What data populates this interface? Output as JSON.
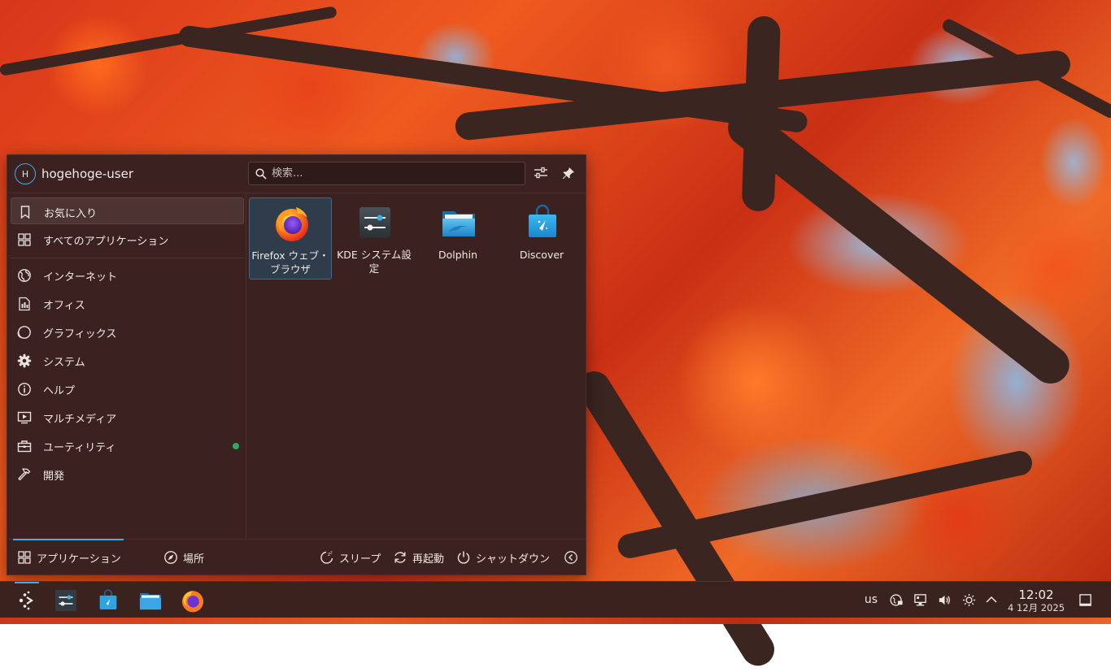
{
  "launcher": {
    "user": {
      "initial": "H",
      "name": "hogehoge-user"
    },
    "search": {
      "placeholder": "検索..."
    },
    "header_icons": {
      "configure": "sliders-icon",
      "pin": "pin-icon"
    },
    "sidebar": {
      "items": [
        {
          "label": "お気に入り",
          "icon": "bookmark-icon"
        },
        {
          "label": "すべてのアプリケーション",
          "icon": "grid-icon"
        },
        {
          "label": "インターネット",
          "icon": "globe-icon"
        },
        {
          "label": "オフィス",
          "icon": "document-icon"
        },
        {
          "label": "グラフィックス",
          "icon": "graphics-icon"
        },
        {
          "label": "システム",
          "icon": "gear-icon"
        },
        {
          "label": "ヘルプ",
          "icon": "info-icon"
        },
        {
          "label": "マルチメディア",
          "icon": "monitor-play-icon"
        },
        {
          "label": "ユーティリティ",
          "icon": "toolbox-icon"
        },
        {
          "label": "開発",
          "icon": "hammer-icon"
        }
      ]
    },
    "apps": [
      {
        "label": "Firefox ウェブ・ブラウザ",
        "icon": "firefox-icon"
      },
      {
        "label": "KDE システム設定",
        "icon": "system-settings-icon"
      },
      {
        "label": "Dolphin",
        "icon": "dolphin-folder-icon"
      },
      {
        "label": "Discover",
        "icon": "discover-bag-icon"
      }
    ],
    "footer": {
      "applications": "アプリケーション",
      "places": "場所",
      "sleep": "スリープ",
      "restart": "再起動",
      "shutdown": "シャットダウン"
    }
  },
  "taskbar": {
    "keyboard_layout": "us",
    "clock": {
      "time": "12:02",
      "date": "4 12月 2025"
    }
  },
  "colors": {
    "panel_bg": "#3b211f",
    "accent": "#3daee9",
    "utility_badge": "#27ae60"
  }
}
